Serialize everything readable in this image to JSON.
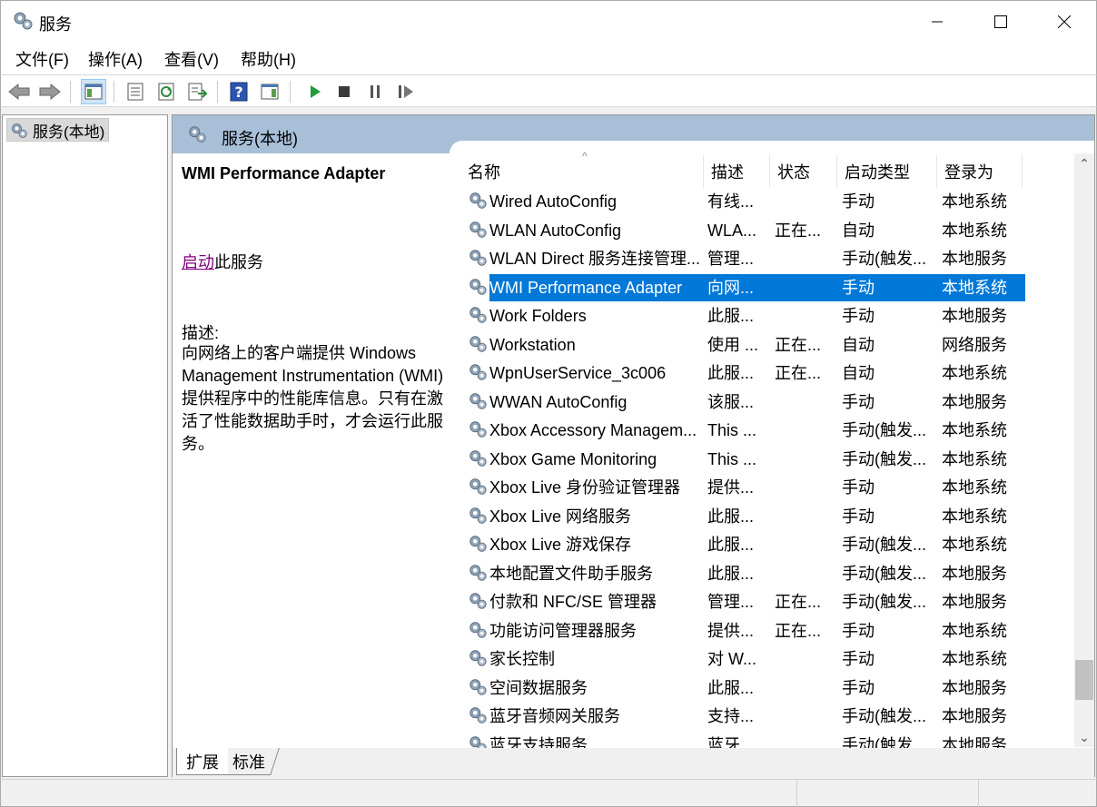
{
  "window": {
    "title": "服务",
    "icon": "gear-icon"
  },
  "menu": [
    "文件(F)",
    "操作(A)",
    "查看(V)",
    "帮助(H)"
  ],
  "toolbar": {
    "buttons": [
      "back-arrow-icon",
      "forward-arrow-icon",
      "console-tree-icon",
      "properties-icon",
      "refresh-icon",
      "export-list-icon",
      "help-icon",
      "action-pane-icon",
      "play-icon",
      "stop-icon",
      "pause-icon",
      "resume-icon"
    ]
  },
  "tree": {
    "root_label": "服务(本地)"
  },
  "panel": {
    "header_title": "服务(本地)"
  },
  "description": {
    "service_title": "WMI Performance Adapter",
    "action_link": "启动",
    "action_suffix": "此服务",
    "label": "描述:",
    "body": "向网络上的客户端提供 Windows Management Instrumentation (WMI) 提供程序中的性能库信息。只有在激活了性能数据助手时，才会运行此服务。"
  },
  "columns": {
    "name": "名称",
    "description": "描述",
    "status": "状态",
    "startup": "启动类型",
    "logon": "登录为"
  },
  "services": [
    {
      "name": "Wired AutoConfig",
      "description": "有线...",
      "status": "",
      "startup": "手动",
      "logon": "本地系统"
    },
    {
      "name": "WLAN AutoConfig",
      "description": "WLA...",
      "status": "正在...",
      "startup": "自动",
      "logon": "本地系统"
    },
    {
      "name": "WLAN Direct 服务连接管理...",
      "description": "管理...",
      "status": "",
      "startup": "手动(触发...",
      "logon": "本地服务"
    },
    {
      "name": "WMI Performance Adapter",
      "description": "向网...",
      "status": "",
      "startup": "手动",
      "logon": "本地系统",
      "selected": true
    },
    {
      "name": "Work Folders",
      "description": "此服...",
      "status": "",
      "startup": "手动",
      "logon": "本地服务"
    },
    {
      "name": "Workstation",
      "description": "使用 ...",
      "status": "正在...",
      "startup": "自动",
      "logon": "网络服务"
    },
    {
      "name": "WpnUserService_3c006",
      "description": "此服...",
      "status": "正在...",
      "startup": "自动",
      "logon": "本地系统"
    },
    {
      "name": "WWAN AutoConfig",
      "description": "该服...",
      "status": "",
      "startup": "手动",
      "logon": "本地服务"
    },
    {
      "name": "Xbox Accessory Managem...",
      "description": "This ...",
      "status": "",
      "startup": "手动(触发...",
      "logon": "本地系统"
    },
    {
      "name": "Xbox Game Monitoring",
      "description": "This ...",
      "status": "",
      "startup": "手动(触发...",
      "logon": "本地系统"
    },
    {
      "name": "Xbox Live 身份验证管理器",
      "description": "提供...",
      "status": "",
      "startup": "手动",
      "logon": "本地系统"
    },
    {
      "name": "Xbox Live 网络服务",
      "description": "此服...",
      "status": "",
      "startup": "手动",
      "logon": "本地系统"
    },
    {
      "name": "Xbox Live 游戏保存",
      "description": "此服...",
      "status": "",
      "startup": "手动(触发...",
      "logon": "本地系统"
    },
    {
      "name": "本地配置文件助手服务",
      "description": "此服...",
      "status": "",
      "startup": "手动(触发...",
      "logon": "本地服务"
    },
    {
      "name": "付款和 NFC/SE 管理器",
      "description": "管理...",
      "status": "正在...",
      "startup": "手动(触发...",
      "logon": "本地服务"
    },
    {
      "name": "功能访问管理器服务",
      "description": "提供...",
      "status": "正在...",
      "startup": "手动",
      "logon": "本地系统"
    },
    {
      "name": "家长控制",
      "description": "对 W...",
      "status": "",
      "startup": "手动",
      "logon": "本地系统"
    },
    {
      "name": "空间数据服务",
      "description": "此服...",
      "status": "",
      "startup": "手动",
      "logon": "本地服务"
    },
    {
      "name": "蓝牙音频网关服务",
      "description": "支持...",
      "status": "",
      "startup": "手动(触发...",
      "logon": "本地服务"
    },
    {
      "name": "蓝牙支持服务",
      "description": "蓝牙...",
      "status": "",
      "startup": "手动(触发...",
      "logon": "本地服务"
    }
  ],
  "tabs": [
    "扩展",
    "标准"
  ]
}
